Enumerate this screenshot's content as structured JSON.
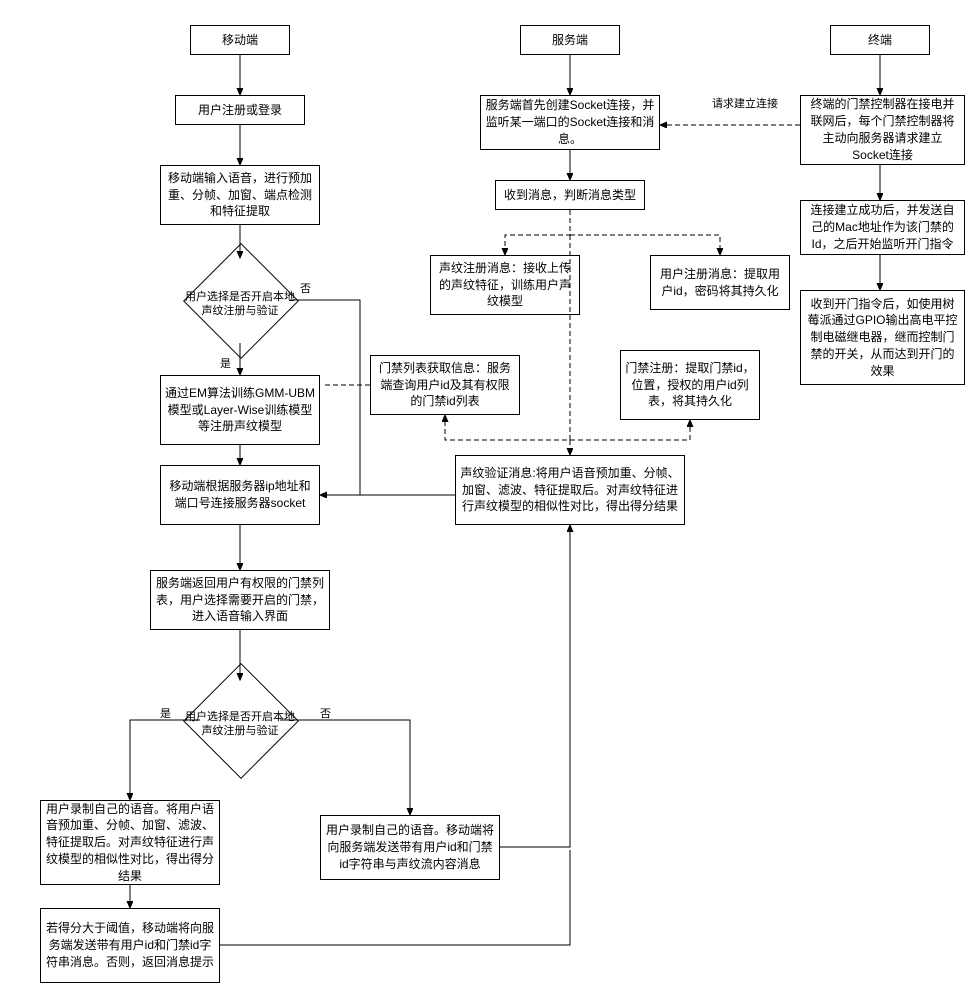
{
  "lanes": {
    "mobile": "移动端",
    "server": "服务端",
    "terminal": "终端"
  },
  "mobile": {
    "register_login": "用户注册或登录",
    "voice_input": "移动端输入语音，进行预加重、分帧、加窗、端点检测和特征提取",
    "decision1": "用户选择是否开启本地声纹注册与验证",
    "train_model": "通过EM算法训练GMM-UBM模型或Layer-Wise训练模型等注册声纹模型",
    "connect_socket": "移动端根据服务器ip地址和端口号连接服务器socket",
    "return_list": "服务端返回用户有权限的门禁列表，用户选择需要开启的门禁，进入语音输入界面",
    "decision2": "用户选择是否开启本地声纹注册与验证",
    "local_record": "用户录制自己的语音。将用户语音预加重、分帧、加窗、滤波、特征提取后。对声纹特征进行声纹模型的相似性对比，得出得分结果",
    "score_send": "若得分大于阈值，移动端将向服务端发送带有用户id和门禁id字符串消息。否则，返回消息提示",
    "remote_record": "用户录制自己的语音。移动端将向服务端发送带有用户id和门禁id字符串与声纹流内容消息"
  },
  "server": {
    "create_socket": "服务端首先创建Socket连接，并监听某一端口的Socket连接和消息。",
    "receive_msg": "收到消息，判断消息类型",
    "vp_register_msg": "声纹注册消息：接收上传的声纹特征，训练用户声纹模型",
    "user_register_msg": "用户注册消息：提取用户id，密码将其持久化",
    "door_list_msg": "门禁列表获取信息：服务端查询用户id及其有权限的门禁id列表",
    "door_register": "门禁注册：提取门禁id，位置，授权的用户id列表，将其持久化",
    "vp_verify_msg": "声纹验证消息:将用户语音预加重、分帧、加窗、滤波、特征提取后。对声纹特征进行声纹模型的相似性对比，得出得分结果"
  },
  "terminal": {
    "controller_connect": "终端的门禁控制器在接电并联网后，每个门禁控制器将主动向服务器请求建立Socket连接",
    "send_mac": "连接建立成功后，并发送自己的Mac地址作为该门禁的Id，之后开始监听开门指令",
    "open_door": "收到开门指令后，如使用树莓派通过GPIO输出高电平控制电磁继电器，继而控制门禁的开关，从而达到开门的效果"
  },
  "labels": {
    "yes": "是",
    "no": "否",
    "request_conn": "请求建立连接"
  }
}
